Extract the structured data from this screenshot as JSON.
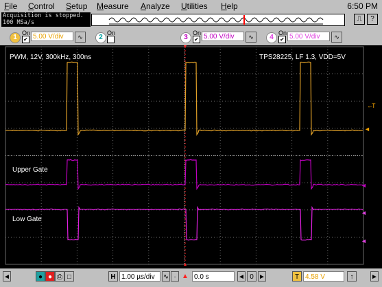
{
  "menu": [
    {
      "underline": "F",
      "rest": "ile"
    },
    {
      "underline": "C",
      "rest": "ontrol"
    },
    {
      "underline": "S",
      "rest": "etup"
    },
    {
      "underline": "M",
      "rest": "easure"
    },
    {
      "underline": "A",
      "rest": "nalyze"
    },
    {
      "underline": "U",
      "rest": "tilities"
    },
    {
      "underline": "H",
      "rest": "elp"
    }
  ],
  "clock": "6:50 PM",
  "status": {
    "line1": "Acquisition is stopped.",
    "line2": "100 MSa/s"
  },
  "channels": [
    {
      "num": "1",
      "on_label": "On",
      "scale": "5.00 V/div",
      "color": "#f0a000",
      "checked": true
    },
    {
      "num": "2",
      "on_label": "On",
      "scale": "",
      "color": "#00c8c8",
      "checked": false
    },
    {
      "num": "3",
      "on_label": "On",
      "scale": "5.00 V/div",
      "color": "#c000c0",
      "checked": true
    },
    {
      "num": "4",
      "on_label": "On",
      "scale": "5.00 V/div",
      "color": "#e040e0",
      "checked": true
    }
  ],
  "screen": {
    "title_left": "PWM, 12V, 300kHz, 300ns",
    "title_right": "TPS28225, LF 1.3, VDD=5V",
    "upper_label": "Upper Gate",
    "lower_label": "Low Gate",
    "trig_marker": "T"
  },
  "colors": {
    "pwm": "#e0a028",
    "upper": "#c000c0",
    "lower": "#e020e0",
    "grid": "#6a6a6a",
    "trigger": "#ff2020"
  },
  "bottom": {
    "time_scale_label": "H",
    "time_scale": "1.00 µs/div",
    "delay": "0.0 s",
    "trig_label": "T",
    "trig_level": "4.58 V"
  }
}
